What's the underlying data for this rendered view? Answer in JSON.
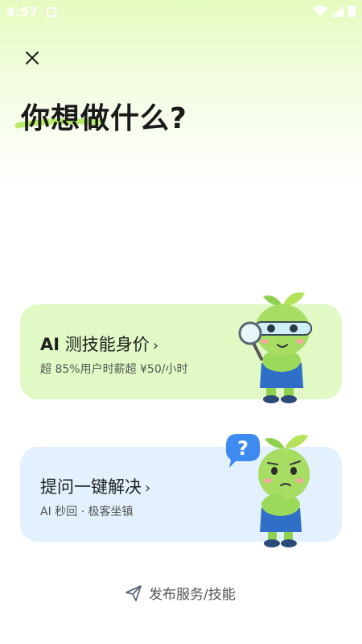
{
  "status_bar": {
    "time": "9:57"
  },
  "header": {
    "title": "你想做什么?"
  },
  "cards": [
    {
      "title_bold": "AI",
      "title_rest": "测技能身价",
      "chevron": "›",
      "subtitle": "超 85%用户时薪超 ¥50/小时"
    },
    {
      "title_bold": "",
      "title_rest": "提问一键解决",
      "chevron": "›",
      "subtitle": "AI 秒回 · 极客坐镇"
    }
  ],
  "bubble_mark": "?",
  "footer": {
    "publish_label": "发布服务/技能"
  },
  "colors": {
    "accent_green": "#b8ec6a",
    "card_green": "#e0f9c5",
    "card_blue": "#e2f1fd",
    "bubble_blue": "#3d8bf0"
  }
}
